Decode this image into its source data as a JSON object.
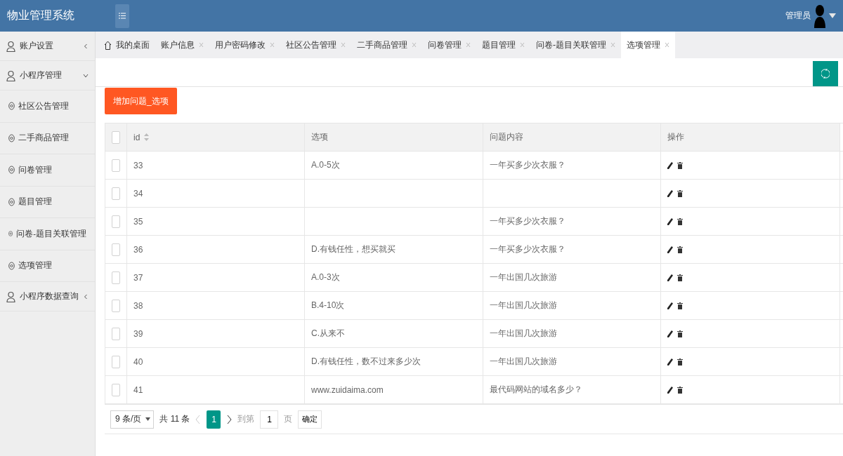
{
  "header": {
    "title": "物业管理系统",
    "user": "管理员"
  },
  "sidebar": {
    "groups": [
      {
        "label": "账户设置",
        "expanded": false
      },
      {
        "label": "小程序管理",
        "expanded": true,
        "children": [
          {
            "label": "社区公告管理"
          },
          {
            "label": "二手商品管理"
          },
          {
            "label": "问卷管理"
          },
          {
            "label": "题目管理"
          },
          {
            "label": "问卷-题目关联管理"
          },
          {
            "label": "选项管理"
          }
        ]
      },
      {
        "label": "小程序数据查询",
        "expanded": false
      }
    ]
  },
  "tabs": [
    {
      "label": "我的桌面",
      "kind": "home",
      "selected": false
    },
    {
      "label": "账户信息",
      "kind": "page",
      "selected": false
    },
    {
      "label": "用户密码修改",
      "kind": "page",
      "selected": false
    },
    {
      "label": "社区公告管理",
      "kind": "page",
      "selected": false
    },
    {
      "label": "二手商品管理",
      "kind": "page",
      "selected": false
    },
    {
      "label": "问卷管理",
      "kind": "page",
      "selected": false
    },
    {
      "label": "题目管理",
      "kind": "page",
      "selected": false
    },
    {
      "label": "问卷-题目关联管理",
      "kind": "page",
      "selected": false
    },
    {
      "label": "选项管理",
      "kind": "page",
      "selected": true
    }
  ],
  "add_button": "增加问题_选项",
  "table": {
    "columns": [
      "id",
      "选项",
      "问题内容",
      "操作"
    ],
    "all_checked": false,
    "rows": [
      {
        "id": "33",
        "option": "A.0-5次",
        "question": "一年买多少次衣服？",
        "checked": false
      },
      {
        "id": "34",
        "checked": false
      },
      {
        "id": "35",
        "question": "一年买多少次衣服？",
        "checked": false
      },
      {
        "id": "36",
        "option": "D.有钱任性，想买就买",
        "question": "一年买多少次衣服？",
        "checked": false
      },
      {
        "id": "37",
        "option": "A.0-3次",
        "question": "一年出国几次旅游",
        "checked": false
      },
      {
        "id": "38",
        "option": "B.4-10次",
        "question": "一年出国几次旅游",
        "checked": false
      },
      {
        "id": "39",
        "option": "C.从来不",
        "question": "一年出国几次旅游",
        "checked": false
      },
      {
        "id": "40",
        "option": "D.有钱任性，数不过来多少次",
        "question": "一年出国几次旅游",
        "checked": false
      },
      {
        "id": "41",
        "option": "www.zuidaima.com",
        "question": "最代码网站的域名多少？",
        "checked": false
      }
    ]
  },
  "pagination": {
    "page_size": "9 条/页",
    "total": "共 11 条",
    "pages": [
      {
        "label": "1",
        "selected": true
      }
    ],
    "goto_label": "到第",
    "goto_value": "1",
    "page_unit": "页",
    "confirm": "确定"
  }
}
